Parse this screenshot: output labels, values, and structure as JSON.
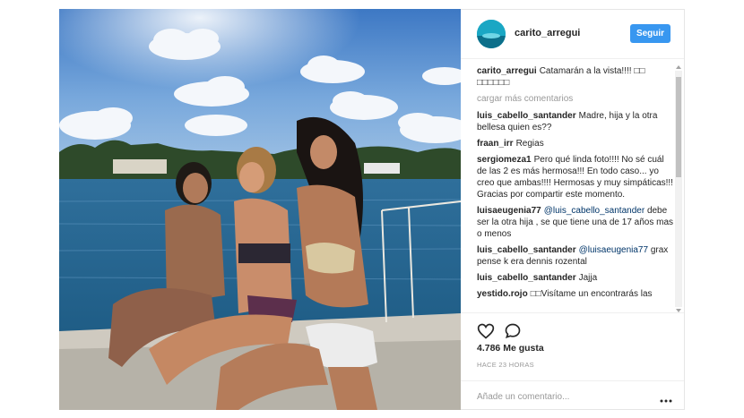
{
  "post": {
    "username": "carito_arregui",
    "follow_label": "Seguir",
    "caption_author": "carito_arregui",
    "caption_text": "Catamarán a la vista!!!! □□ □□□□□□",
    "load_more": "cargar más comentarios",
    "comments": [
      {
        "author": "luis_cabello_santander",
        "text": "Madre, hija y la otra bellesa quien es??"
      },
      {
        "author": "fraan_irr",
        "text": "Regias"
      },
      {
        "author": "sergiomeza1",
        "text": "Pero qué linda foto!!!! No sé cuál de las 2 es más hermosa!!! En todo caso... yo creo que ambas!!!! Hermosas y muy simpáticas!!! Gracias por compartir este momento."
      },
      {
        "author": "luisaeugenia77",
        "mention": "@luis_cabello_santander",
        "text": "debe ser la otra hija , se que tiene una de 17 años mas o menos"
      },
      {
        "author": "luis_cabello_santander",
        "mention": "@luisaeugenia77",
        "text": "grax pense k era dennis rozental"
      },
      {
        "author": "luis_cabello_santander",
        "text": "Jajja"
      },
      {
        "author": "yestido.rojo",
        "text": "□□Visítame un encontrarás las"
      }
    ],
    "likes": "4.786 Me gusta",
    "timestamp": "HACE 23 HORAS",
    "comment_placeholder": "Añade un comentario..."
  },
  "colors": {
    "accent": "#3897f0",
    "mention": "#003569",
    "muted": "#999999"
  },
  "icons": [
    "heart-icon",
    "comment-icon",
    "more-options-icon"
  ]
}
